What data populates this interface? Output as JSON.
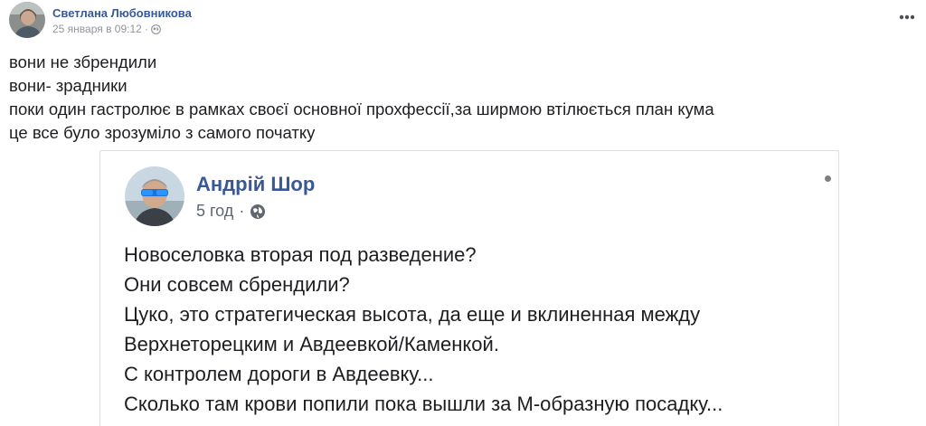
{
  "post": {
    "author": "Светлана Любовникова",
    "date": "25 января в 09:12",
    "separator": "·",
    "more_icon": "more-horizontal-icon",
    "privacy_icon": "globe-icon",
    "lines": [
      "вони не збрендили",
      "вони- зрадники",
      "поки один гастролює в рамках своєї основної прохфессії,за ширмою втілюється план кума",
      "це все було зрозуміло з самого початку"
    ]
  },
  "shared": {
    "author": "Андрій Шор",
    "time": "5 год",
    "separator": "·",
    "privacy_icon": "globe-icon",
    "lines": [
      "Новоселовка вторая под разведение?",
      "Они совсем сбрендили?",
      "Цуко, это стратегическая высота, да еще и вклиненная между",
      "Верхнеторецким и Авдеевкой/Каменкой.",
      "С контролем дороги в Авдеевку...",
      "Сколько там крови попили пока вышли за М-образную посадку..."
    ]
  }
}
